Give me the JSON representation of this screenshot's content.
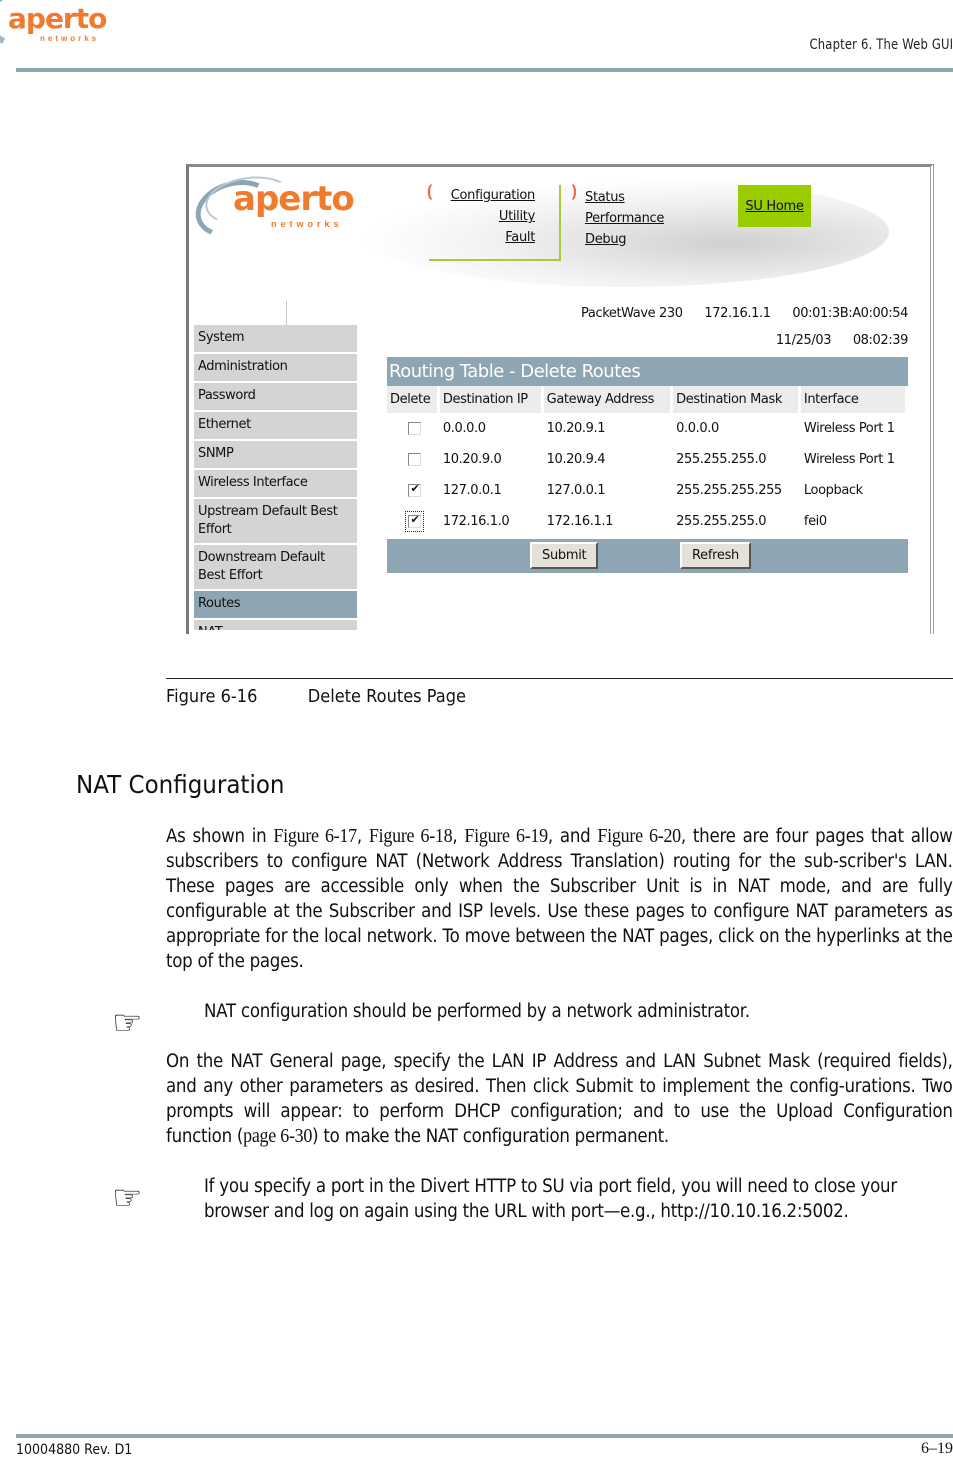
{
  "header": {
    "logo_word": "aperto",
    "logo_sub": "networks",
    "chapter": "Chapter 6.  The Web GUI"
  },
  "screenshot": {
    "logo_word": "aperto",
    "logo_sub": "networks",
    "nav_left": [
      "Configuration",
      "Utility",
      "Fault"
    ],
    "nav_right": [
      "Status",
      "Performance",
      "Debug"
    ],
    "su_home": "SU Home",
    "device": {
      "model": "PacketWave 230",
      "ip": "172.16.1.1",
      "mac": "00:01:3B:A0:00:54",
      "date": "11/25/03",
      "time": "08:02:39"
    },
    "sidebar": [
      {
        "label": "System",
        "active": false
      },
      {
        "label": "Administration",
        "active": false
      },
      {
        "label": "Password",
        "active": false
      },
      {
        "label": "Ethernet",
        "active": false
      },
      {
        "label": "SNMP",
        "active": false
      },
      {
        "label": "Wireless Interface",
        "active": false
      },
      {
        "label": "Upstream Default Best Effort",
        "active": false
      },
      {
        "label": "Downstream Default Best Effort",
        "active": false
      },
      {
        "label": "Routes",
        "active": true
      },
      {
        "label": "NAT",
        "active": false
      }
    ],
    "routing_table": {
      "title": "Routing Table - Delete Routes",
      "columns": [
        "Delete",
        "Destination IP",
        "Gateway Address",
        "Destination Mask",
        "Interface"
      ],
      "rows": [
        {
          "delete": false,
          "dest_ip": "0.0.0.0",
          "gateway": "10.20.9.1",
          "mask": "0.0.0.0",
          "iface": "Wireless Port 1",
          "focused": false
        },
        {
          "delete": false,
          "dest_ip": "10.20.9.0",
          "gateway": "10.20.9.4",
          "mask": "255.255.255.0",
          "iface": "Wireless Port 1",
          "focused": false
        },
        {
          "delete": true,
          "dest_ip": "127.0.0.1",
          "gateway": "127.0.0.1",
          "mask": "255.255.255.255",
          "iface": "Loopback",
          "focused": false
        },
        {
          "delete": true,
          "dest_ip": "172.16.1.0",
          "gateway": "172.16.1.1",
          "mask": "255.255.255.0",
          "iface": "fei0",
          "focused": true
        }
      ],
      "submit_label": "Submit",
      "refresh_label": "Refresh"
    }
  },
  "caption": {
    "number": "Figure 6-16",
    "title": "Delete Routes Page"
  },
  "section": {
    "heading": "NAT Configuration",
    "para1": {
      "pre": "As shown in ",
      "ref1": "Figure 6-17",
      "sep1": ", ",
      "ref2": "Figure 6-18",
      "sep2": ", ",
      "ref3": "Figure 6-19",
      "sep3": ", and ",
      "ref4": "Figure 6-20",
      "post": ", there are four pages that allow subscribers to configure NAT (Network Address Translation) routing for the sub-scriber's LAN. These pages are accessible only when the Subscriber Unit is in NAT mode, and are fully configurable at the Subscriber and ISP levels. Use these pages to configure NAT parameters as appropriate for the local network. To move between the NAT pages, click on the hyperlinks at the top of the pages."
    },
    "note1": "NAT configuration should be performed by a network administrator.",
    "para2": {
      "pre": "On the NAT General page, specify the LAN IP Address and LAN Subnet Mask (required fields), and any other parameters as desired. Then click Submit to implement the config-urations. Two prompts will appear: to perform DHCP configuration; and to use the Upload Configuration function (",
      "ref": "page 6-30",
      "post": ") to make the NAT configuration permanent."
    },
    "note2": "If you specify a port in the Divert HTTP to SU via port field, you will need to close your browser and log on again using the URL with port—e.g., http://10.10.16.2:5002."
  },
  "footer": {
    "doc_id": "10004880 Rev. D1",
    "page": "6–19"
  },
  "icons": {
    "note": "pointing-hand-icon"
  }
}
